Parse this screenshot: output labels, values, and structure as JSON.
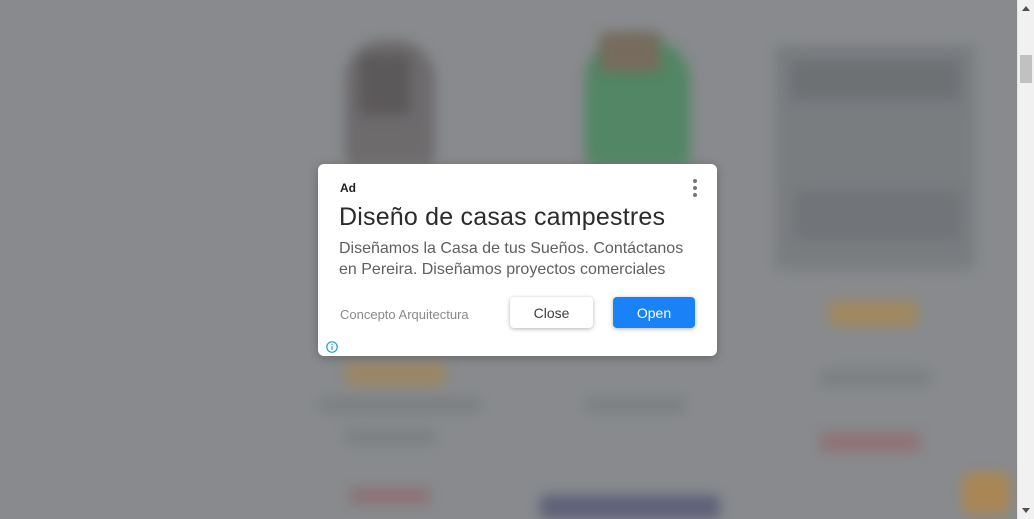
{
  "ad": {
    "label": "Ad",
    "title": "Diseño de casas campestres",
    "description": "Diseñamos la Casa de tus Sueños. Contáctanos en Pereira. Diseñamos proyectos comerciales",
    "advertiser": "Concepto Arquitectura",
    "close_label": "Close",
    "open_label": "Open"
  },
  "icons": {
    "menu": "more-vert-icon",
    "info": "info-icon",
    "scroll_up": "scroll-up-arrow-icon",
    "scroll_down": "scroll-down-arrow-icon"
  },
  "colors": {
    "open_button": "#1a82f7",
    "info_icon": "#1a9fd9",
    "backdrop": "#8d8f92"
  }
}
